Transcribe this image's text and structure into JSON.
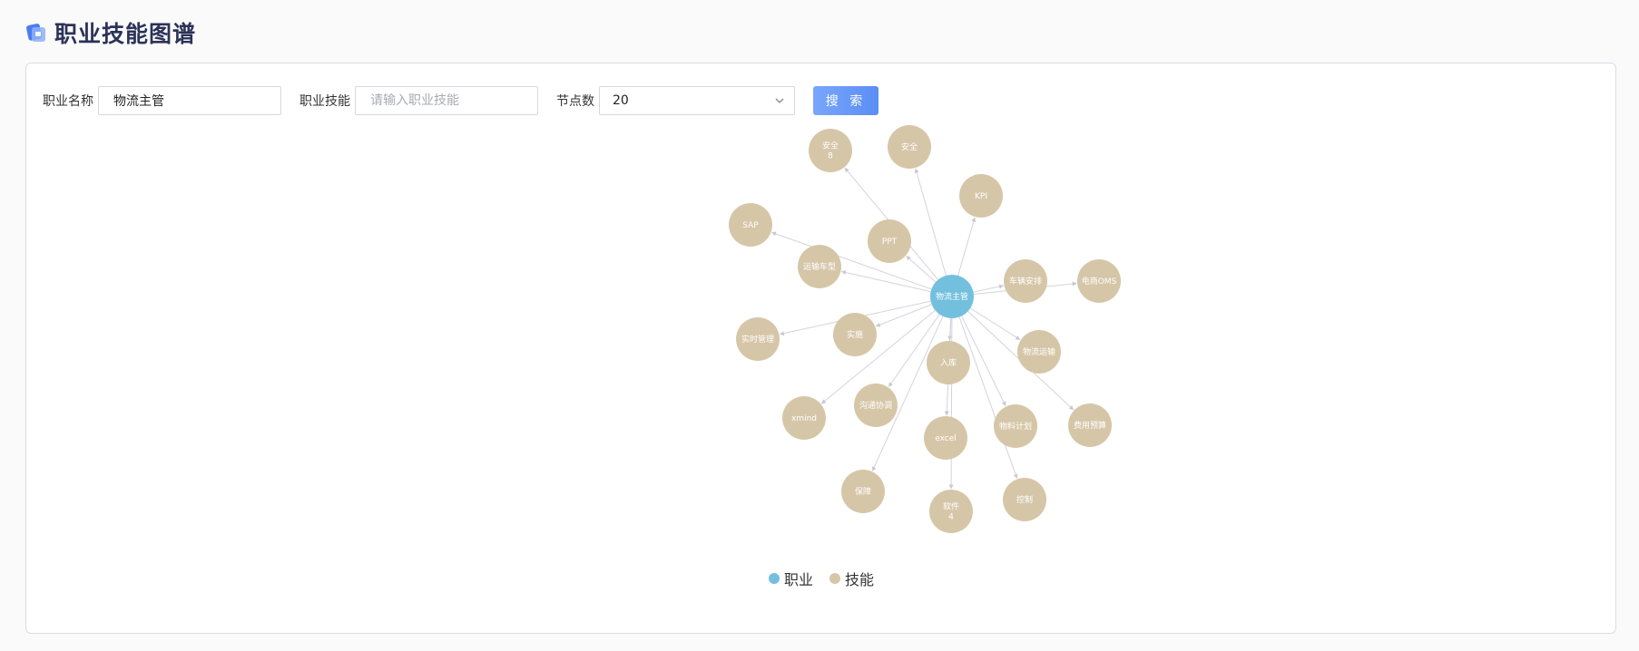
{
  "header": {
    "title": "职业技能图谱"
  },
  "search": {
    "job_label": "职业名称",
    "job_value": "物流主管",
    "skill_label": "职业技能",
    "skill_placeholder": "请输入职业技能",
    "count_label": "节点数",
    "count_value": "20",
    "button_label": "搜 索"
  },
  "legend": [
    {
      "label": "职业",
      "color": "#73c0de"
    },
    {
      "label": "技能",
      "color": "#d6c6a8"
    }
  ],
  "colors": {
    "job": "#73c0de",
    "skill": "#d6c6a8",
    "edge": "#d3d3dc"
  },
  "graph": {
    "center": "物流主管",
    "skills": [
      "安全\n8",
      "安全",
      "KPI",
      "SAP",
      "PPT",
      "运输车型",
      "车辆安排",
      "电商OMS",
      "实时管理",
      "实施",
      "物流运输",
      "入库",
      "xmind",
      "沟通协调",
      "物料计划",
      "费用预算",
      "excel",
      "保障",
      "软件\n4",
      "控制"
    ]
  }
}
